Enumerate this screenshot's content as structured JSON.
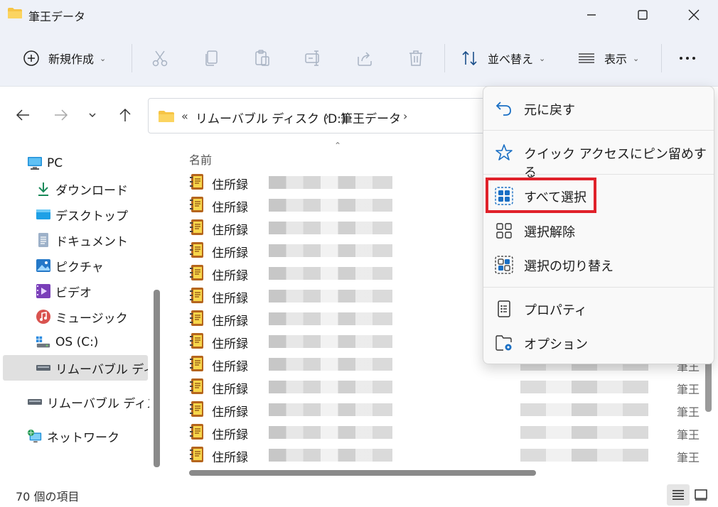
{
  "window": {
    "title": "筆王データ",
    "minimize_icon": "minimize-icon",
    "maximize_icon": "maximize-icon",
    "close_icon": "close-icon"
  },
  "toolbar": {
    "new_label": "新規作成",
    "sort_label": "並べ替え",
    "view_label": "表示",
    "more_icon": "more-icon"
  },
  "address": {
    "overflow": "«",
    "crumbs": [
      "リムーバブル ディスク (D:)",
      "筆王データ"
    ],
    "separator": "›"
  },
  "sidebar": {
    "items": [
      {
        "label": "PC",
        "icon": "pc-icon"
      },
      {
        "label": "ダウンロード",
        "icon": "download-icon"
      },
      {
        "label": "デスクトップ",
        "icon": "desktop-icon"
      },
      {
        "label": "ドキュメント",
        "icon": "document-icon"
      },
      {
        "label": "ピクチャ",
        "icon": "picture-icon"
      },
      {
        "label": "ビデオ",
        "icon": "video-icon"
      },
      {
        "label": "ミュージック",
        "icon": "music-icon"
      },
      {
        "label": "OS (C:)",
        "icon": "drive-c-icon"
      },
      {
        "label": "リムーバブル ディスク",
        "icon": "removable-drive-icon",
        "selected": true
      },
      {
        "label": "リムーバブル ディスク",
        "icon": "removable-drive-icon"
      },
      {
        "label": "ネットワーク",
        "icon": "network-icon"
      }
    ]
  },
  "filelist": {
    "column_name": "名前",
    "rows": [
      {
        "name": "住所録",
        "type": ""
      },
      {
        "name": "住所録",
        "type": ""
      },
      {
        "name": "住所録",
        "type": ""
      },
      {
        "name": "住所録",
        "type": ""
      },
      {
        "name": "住所録",
        "type": ""
      },
      {
        "name": "住所録",
        "type": ""
      },
      {
        "name": "住所録",
        "type": ""
      },
      {
        "name": "住所録",
        "type": ""
      },
      {
        "name": "住所録",
        "type": "筆王"
      },
      {
        "name": "住所録",
        "type": "筆王"
      },
      {
        "name": "住所録",
        "type": "筆王"
      },
      {
        "name": "住所録",
        "type": "筆王"
      },
      {
        "name": "住所録",
        "type": "筆王"
      }
    ]
  },
  "status": {
    "item_count": "70 個の項目"
  },
  "context_menu": {
    "items": [
      {
        "label": "元に戻す",
        "icon": "undo-icon"
      },
      {
        "label": "クイック アクセスにピン留めする",
        "icon": "star-icon"
      },
      {
        "label": "すべて選択",
        "icon": "select-all-icon",
        "highlighted": true
      },
      {
        "label": "選択解除",
        "icon": "select-none-icon"
      },
      {
        "label": "選択の切り替え",
        "icon": "invert-selection-icon"
      },
      {
        "label": "プロパティ",
        "icon": "properties-icon"
      },
      {
        "label": "オプション",
        "icon": "options-icon"
      }
    ],
    "highlight_color": "#e0212a",
    "accent_color": "#1a6fc4"
  }
}
